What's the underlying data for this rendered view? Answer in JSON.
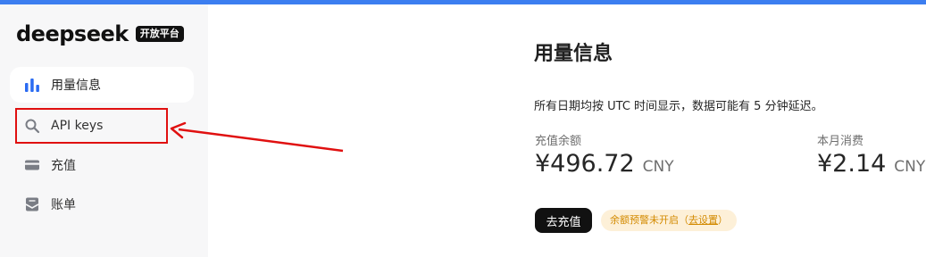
{
  "colors": {
    "top_bar": "#3c7ef0",
    "accent_blue": "#2a6bf2",
    "highlight_red": "#e01010",
    "alert_bg": "#fdf0d8",
    "alert_text": "#d38a00"
  },
  "brand": {
    "name": "deepseek",
    "badge": "开放平台"
  },
  "sidebar": {
    "items": [
      {
        "label": "用量信息",
        "icon": "bar-chart-icon",
        "active": true
      },
      {
        "label": "API keys",
        "icon": "search-icon",
        "active": false
      },
      {
        "label": "充值",
        "icon": "wallet-icon",
        "active": false
      },
      {
        "label": "账单",
        "icon": "bill-icon",
        "active": false
      }
    ]
  },
  "main": {
    "title": "用量信息",
    "notice": "所有日期均按 UTC 时间显示，数据可能有 5 分钟延迟。",
    "balance": {
      "label": "充值余额",
      "amount": "¥496.72",
      "currency": "CNY"
    },
    "monthly": {
      "label": "本月消费",
      "amount": "¥2.14",
      "currency": "CNY"
    },
    "topup_button": "去充值",
    "alert": {
      "text": "余额预警未开启（",
      "link": "去设置",
      "close": "）"
    }
  }
}
